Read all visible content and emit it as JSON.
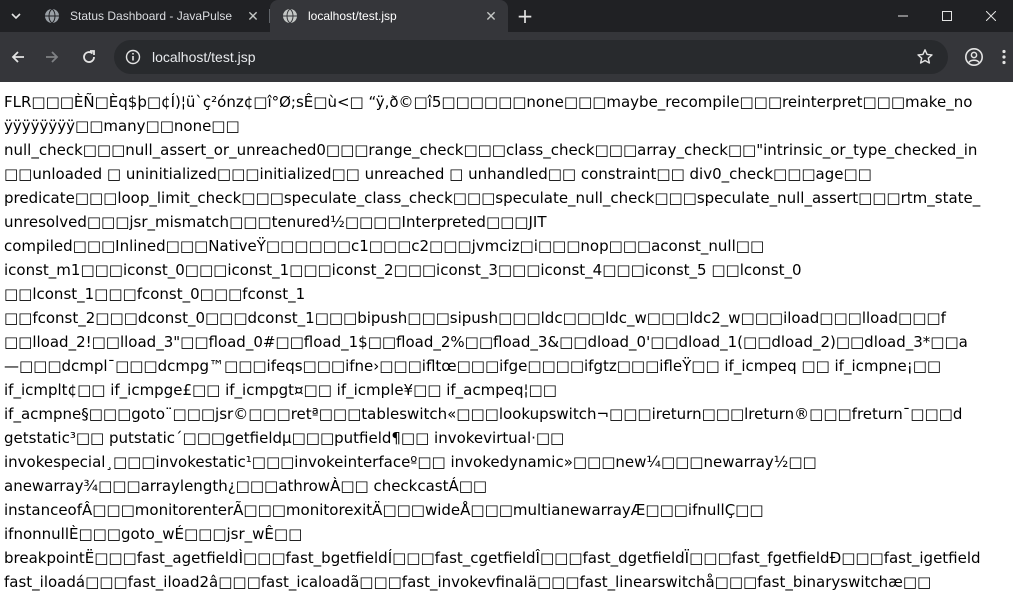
{
  "tabs": [
    {
      "title": "Status Dashboard - JavaPulse",
      "active": false
    },
    {
      "title": "localhost/test.jsp",
      "active": true
    }
  ],
  "address_bar": {
    "url": "localhost/test.jsp"
  },
  "icons": {
    "tab_list": "chevron-down-icon",
    "tab1_favicon": "globe-icon",
    "tab2_favicon": "globe-icon",
    "close": "close-icon",
    "new_tab": "plus-icon",
    "minimize": "minimize-icon",
    "maximize": "maximize-icon",
    "window_close": "window-close-icon",
    "back": "back-arrow-icon",
    "forward": "forward-arrow-icon",
    "reload": "reload-icon",
    "site_info": "info-icon",
    "bookmark": "star-icon",
    "profile": "profile-icon",
    "menu": "kebab-menu-icon"
  },
  "colors": {
    "tabstrip": "#202124",
    "toolbar": "#35363a",
    "omnibox": "#282a2d",
    "page": "#ffffff"
  },
  "page_lines": [
    "FLR□□□ÈÑ□Èq$þ□¢Í)¦ü`ç²ónz¢□î°Ø;sÊ□ù<□ “ÿ,ð©□î5□□□□□□none□□□maybe_recompile□□□reinterpret□□□make_no",
    "ÿÿÿÿÿÿÿÿ□□many□□none□□",
    "null_check□□□null_assert_or_unreached0□□□range_check□□□class_check□□□array_check□□\"intrinsic_or_type_checked_in",
    "□□unloaded □ uninitialized□□□initialized□□ unreached □ unhandled□□ constraint□□ div0_check□□□age□□",
    "predicate□□□loop_limit_check□□□speculate_class_check□□□speculate_null_check□□□speculate_null_assert□□□rtm_state_",
    "unresolved□□□jsr_mismatch□□□tenured½□□□□Interpreted□□□JIT",
    "compiled□□□Inlined□□□NativeŸ□□□□□□c1□□□c2□□□jvmciz□i□□□nop□□□aconst_null□□",
    "iconst_m1□□□iconst_0□□□iconst_1□□□iconst_2□□□iconst_3□□□iconst_4□□□iconst_5 □□lconst_0",
    "□□lconst_1□□□fconst_0□□□fconst_1",
    "□□fconst_2□□□dconst_0□□□dconst_1□□□bipush□□□sipush□□□ldc□□□ldc_w□□□ldc2_w□□□iload□□□lload□□□f",
    "□□lload_2!□□lload_3\"□□fload_0#□□fload_1$□□fload_2%□□fload_3&□□dload_0'□□dload_1(□□dload_2)□□dload_3*□□a",
    "—□□□dcmpl¯□□□dcmpg™□□□ifeqs□□□ifne›□□□ifltœ□□□ifge□□□□ifgtz□□□ifleŸ□□ if_icmpeq □□ if_icmpne¡□□",
    "if_icmplt¢□□ if_icmpge£□□ if_icmpgt¤□□ if_icmple¥□□ if_acmpeq¦□□",
    "if_acmpne§□□□goto¨□□□jsr©□□□retª□□□tableswitch«□□□lookupswitch¬□□□ireturn□□□lreturn®□□□freturn¯□□□d",
    "getstatic³□□ putstatic´□□□getfieldµ□□□putfield¶□□ invokevirtual·□□",
    "invokespecial¸□□□invokestatic¹□□□invokeinterfaceº□□ invokedynamic»□□□new¼□□□newarray½□□",
    "anewarray¾□□□arraylength¿□□□athrowÀ□□ checkcastÁ□□",
    "instanceofÂ□□□monitorenterÃ□□□monitorexitÄ□□□wideÅ□□□multianewarrayÆ□□□ifnullÇ□□",
    "ifnonnullÈ□□□goto_wÉ□□□jsr_wÊ□□",
    "breakpointË□□□fast_agetfieldÌ□□□fast_bgetfieldÍ□□□fast_cgetfieldÎ□□□fast_dgetfieldÏ□□□fast_fgetfieldÐ□□□fast_igetfield",
    "fast_iloadá□□□fast_iload2â□□□fast_icaloadã□□□fast_invokevfinalä□□□fast_linearswitchå□□□fast_binaryswitchæ□□"
  ]
}
